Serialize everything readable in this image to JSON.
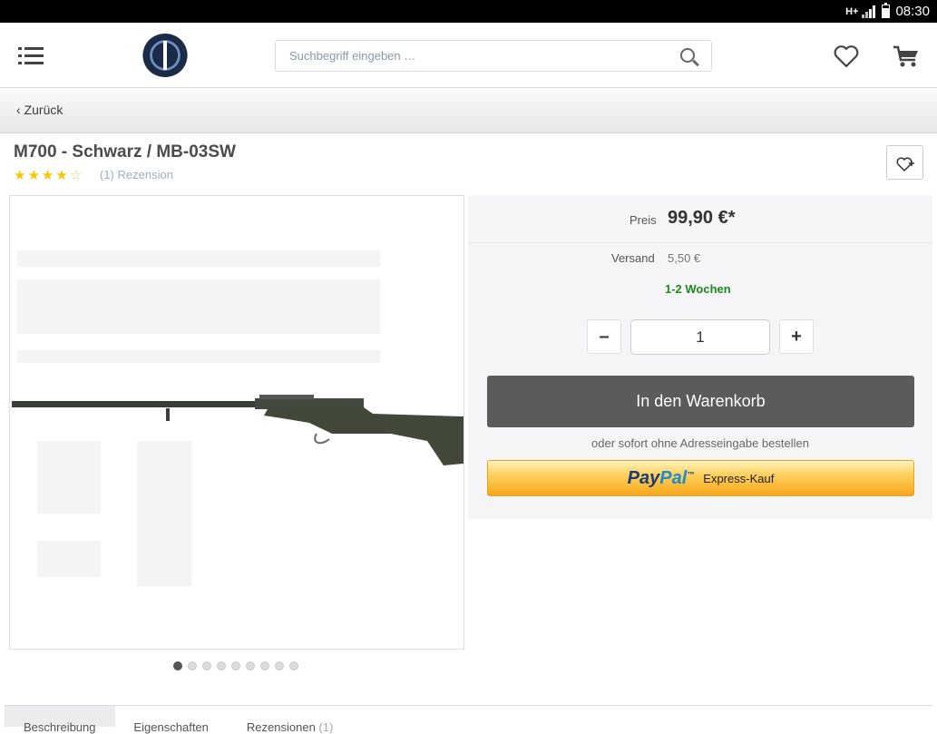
{
  "status_bar": {
    "network": "H+",
    "time": "08:30"
  },
  "header": {
    "search_placeholder": "Suchbegriff eingeben …"
  },
  "back_label": "Zurück",
  "product": {
    "title": "M700 - Schwarz / MB-03SW",
    "rating": 4,
    "rating_max": 5,
    "review_count_label": "(1) Rezension",
    "image_count": 9,
    "active_image": 1
  },
  "buy_box": {
    "price_label": "Preis",
    "price": "99,90 €*",
    "shipping_label": "Versand",
    "shipping": "5,50 €",
    "delivery": "1-2 Wochen",
    "quantity": "1",
    "minus": "–",
    "plus": "+",
    "add_to_cart": "In den Warenkorb",
    "express_note": "oder sofort ohne Adresseingabe bestellen",
    "paypal_logo_a": "Pay",
    "paypal_logo_b": "Pal",
    "paypal_label": "Express-Kauf"
  },
  "tabs": [
    {
      "label": "Beschreibung"
    },
    {
      "label": "Eigenschaften"
    },
    {
      "label": "Rezensionen",
      "count": "(1)"
    }
  ],
  "colors": {
    "accent_dark": "#5b5b5b",
    "delivery_green": "#1f8a1f",
    "star": "#f5c500"
  }
}
